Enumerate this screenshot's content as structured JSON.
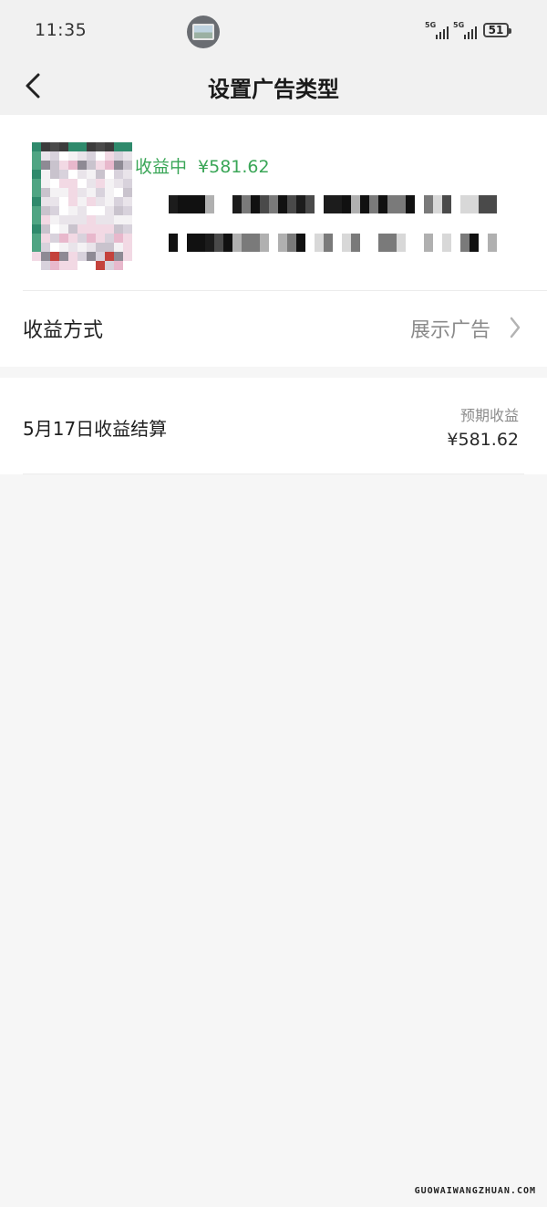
{
  "status_bar": {
    "time": "11:35",
    "network_1": "5G",
    "network_2": "5G",
    "battery_level": "51",
    "icons": [
      "app-notification-icon",
      "signal-icon",
      "signal-icon",
      "battery-icon"
    ]
  },
  "nav": {
    "title": "设置广告类型",
    "back_icon": "chevron-left-icon"
  },
  "ad_card": {
    "status_label": "收益中",
    "earnings": "¥581.62",
    "colors": {
      "status_green": "#3aa657"
    }
  },
  "income_method": {
    "label": "收益方式",
    "value": "展示广告",
    "icon": "chevron-right-icon"
  },
  "settlement": {
    "date_label": "5月17日收益结算",
    "caption": "预期收益",
    "amount": "¥581.62"
  },
  "watermark": "GUOWAIWANGZHUAN.COM"
}
